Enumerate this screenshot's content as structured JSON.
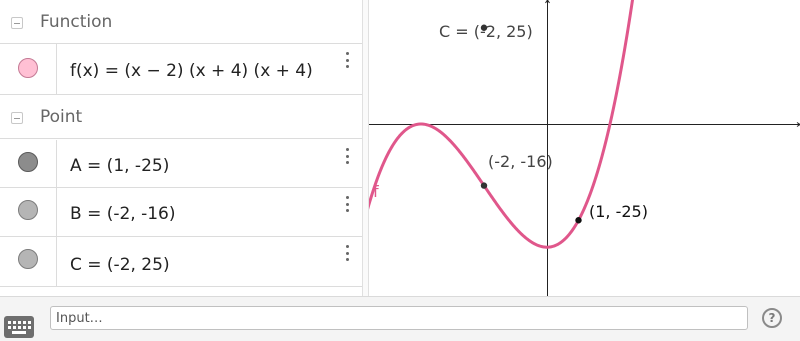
{
  "algebra": {
    "function_header": "Function",
    "point_header": "Point",
    "function_row": {
      "text": "f(x)  =  (x − 2) (x + 4) (x + 4)",
      "color": "#ff99bb"
    },
    "point_rows": [
      {
        "text": "A = (1, -25)",
        "color": "#6e6e6e"
      },
      {
        "text": "B = (-2, -16)",
        "color": "#a9a9a9"
      },
      {
        "text": "C = (-2, 25)",
        "color": "#a9a9a9"
      }
    ]
  },
  "graphics": {
    "curve_label": "f",
    "curve_color": "#e0578b",
    "point_labels": {
      "C": "C = (-2, 25)",
      "B": "(-2, -16)",
      "A": "(1, -25)"
    },
    "function": {
      "expression": "(x - 2)(x + 4)(x + 4)",
      "roots": [
        -4,
        2
      ]
    },
    "points": [
      {
        "name": "A",
        "x": 1,
        "y": -25
      },
      {
        "name": "B",
        "x": -2,
        "y": -16
      },
      {
        "name": "C",
        "x": -2,
        "y": 25
      }
    ]
  },
  "input_bar": {
    "placeholder": "Input…",
    "help_label": "?",
    "keyboard_icon": "keyboard-icon"
  }
}
